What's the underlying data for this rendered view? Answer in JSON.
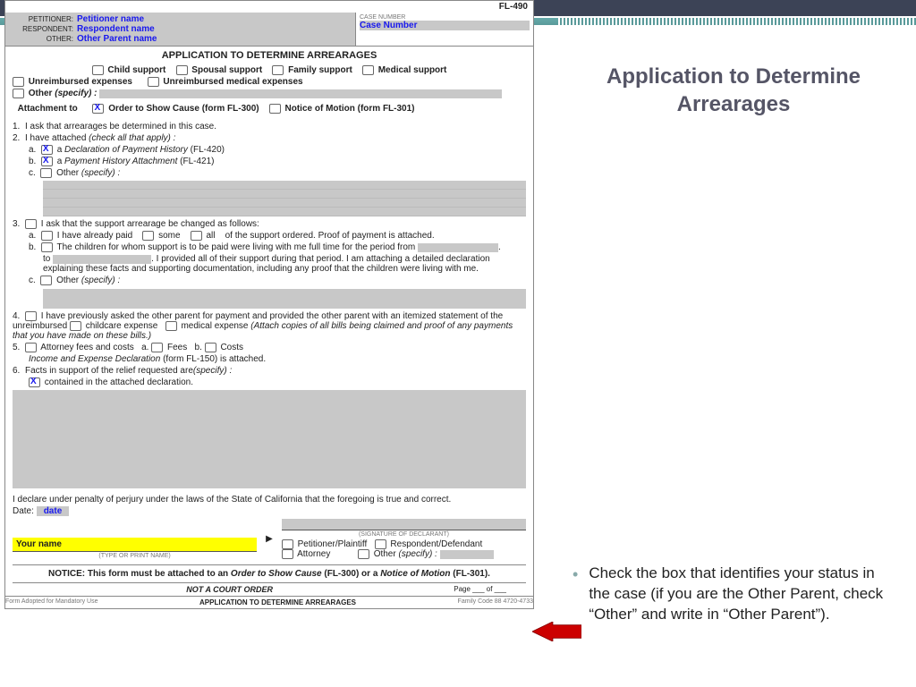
{
  "formCode": "FL-490",
  "hdr": {
    "pet": "PETITIONER:",
    "petV": "Petitioner name",
    "res": "RESPONDENT:",
    "resV": "Respondent name",
    "oth": "OTHER:",
    "othV": "Other Parent name",
    "caseLbl": "CASE NUMBER",
    "caseV": "Case Number"
  },
  "title": "APPLICATION TO DETERMINE ARREARAGES",
  "support": {
    "child": "Child support",
    "spousal": "Spousal support",
    "family": "Family support",
    "medical": "Medical support"
  },
  "exp": {
    "unreimb": "Unreimbursed expenses",
    "med": "Unreimbursed medical expenses",
    "other": "Other",
    "spec": "(specify) :"
  },
  "att": {
    "lbl": "Attachment to",
    "osc": "Order to Show Cause (form FL-300)",
    "nom": "Notice of Motion (form FL-301)"
  },
  "q1": "I ask that arrearages be determined in this case.",
  "q2": {
    "head": "I have attached",
    "hint": "(check all that apply) :",
    "a": "a",
    "aT": "Declaration of Payment History",
    "aF": " (FL-420)",
    "b": "a",
    "bT": "Payment History Attachment",
    "bF": " (FL-421)",
    "c": "Other",
    "cS": "(specify) :"
  },
  "q3": {
    "head": "I ask that the support arrearage be changed as follows:",
    "a": "I have already paid",
    "some": "some",
    "all": "all",
    "aEnd": "of the support ordered. Proof of payment is attached.",
    "b1": "The children for whom support is to be paid were living with me full time for the period from",
    "b2": "to",
    "b3": ".  I provided all of their support during that period. I am attaching a detailed declaration explaining these facts and supporting documentation, including any proof that the children were living with me.",
    "c": "Other",
    "cS": "(specify) :"
  },
  "q4": {
    "a": "I have previously asked the other parent for payment and provided the other parent with an itemized statement of the unreimbursed",
    "cc": "childcare expense",
    "me": "medical expense",
    "b": "(Attach copies of all bills being claimed and proof of any payments that you have made on these bills.)"
  },
  "q5": {
    "a": "Attorney fees and costs",
    "fees": "Fees",
    "costs": "Costs",
    "b": "Income and Expense Declaration",
    "c": " (form FL-150) is attached."
  },
  "q6": {
    "a": "Facts in support of the relief requested are",
    "s": "(specify) :",
    "b": "contained in the attached declaration."
  },
  "decl": "I declare under penalty of perjury under the laws of the State of California that the foregoing is true and correct.",
  "date": {
    "lbl": "Date:",
    "v": "date"
  },
  "name": "Your name",
  "sig": {
    "type": "(TYPE OR PRINT NAME)",
    "sig": "(SIGNATURE OF DECLARANT)"
  },
  "role": {
    "pp": "Petitioner/Plaintiff",
    "rd": "Respondent/Defendant",
    "att": "Attorney",
    "oth": "Other",
    "spec": "(specify) :"
  },
  "notice": {
    "a": "NOTICE:  This form must be attached to an ",
    "b": "Order to Show Cause",
    "c": " (FL-300) or a ",
    "d": "Notice of Motion",
    "e": " (FL-301)."
  },
  "nco": "NOT A COURT ORDER",
  "foot": "APPLICATION TO DETERMINE ARREARAGES",
  "page": "Page",
  "of": "of",
  "tiny1": "Form Adopted for Mandatory Use",
  "tiny2": "Family Code 88 4720-4733",
  "rtitle": "Application to Determine Arrearages",
  "bullet": "Check the box that identifies your status in the case  (if you are the Other Parent, check “Other” and write in “Other Parent”)."
}
